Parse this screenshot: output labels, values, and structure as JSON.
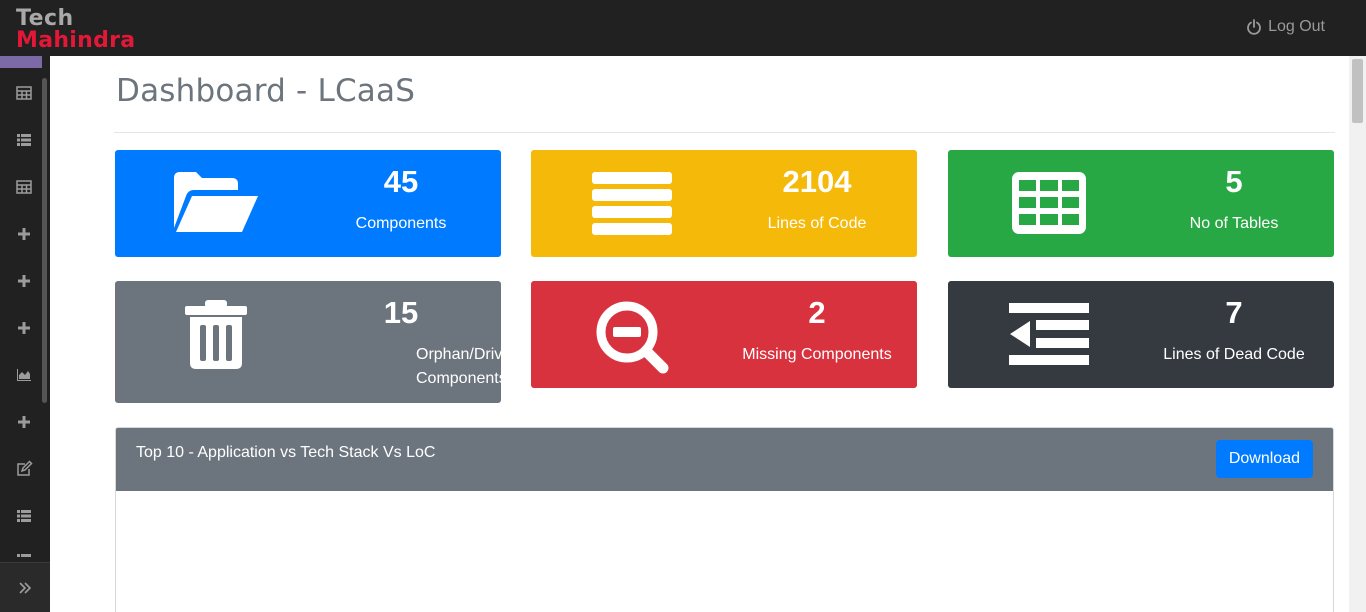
{
  "brand": {
    "line1": "Tech",
    "line2": "Mahindra"
  },
  "header": {
    "logout_label": "Log Out"
  },
  "sidebar": {
    "items": [
      {
        "icon": "table-icon"
      },
      {
        "icon": "list-icon"
      },
      {
        "icon": "table-icon"
      },
      {
        "icon": "plus-icon"
      },
      {
        "icon": "plus-icon"
      },
      {
        "icon": "plus-icon"
      },
      {
        "icon": "area-chart-icon"
      },
      {
        "icon": "plus-icon"
      },
      {
        "icon": "edit-icon"
      },
      {
        "icon": "list-icon"
      }
    ],
    "toggle_icon": "double-chevron-right-icon"
  },
  "page": {
    "title": "Dashboard - LCaaS"
  },
  "cards": [
    {
      "value": "45",
      "label": "Components",
      "color": "#007bff",
      "icon": "folder-open-icon"
    },
    {
      "value": "2104",
      "label": "Lines of Code",
      "color": "#f5b90a",
      "icon": "bars-icon"
    },
    {
      "value": "5",
      "label": "No of Tables",
      "color": "#28a745",
      "icon": "table-icon"
    },
    {
      "value": "15",
      "label": "Orphan/Driver Components",
      "color": "#6c757d",
      "icon": "trash-icon"
    },
    {
      "value": "2",
      "label": "Missing Components",
      "color": "#d9323f",
      "icon": "search-minus-icon"
    },
    {
      "value": "7",
      "label": "Lines of Dead Code",
      "color": "#343a40",
      "icon": "outdent-icon"
    }
  ],
  "panel": {
    "title": "Top 10 - Application vs Tech Stack Vs LoC",
    "download_label": "Download",
    "header_color": "#6c757d"
  }
}
